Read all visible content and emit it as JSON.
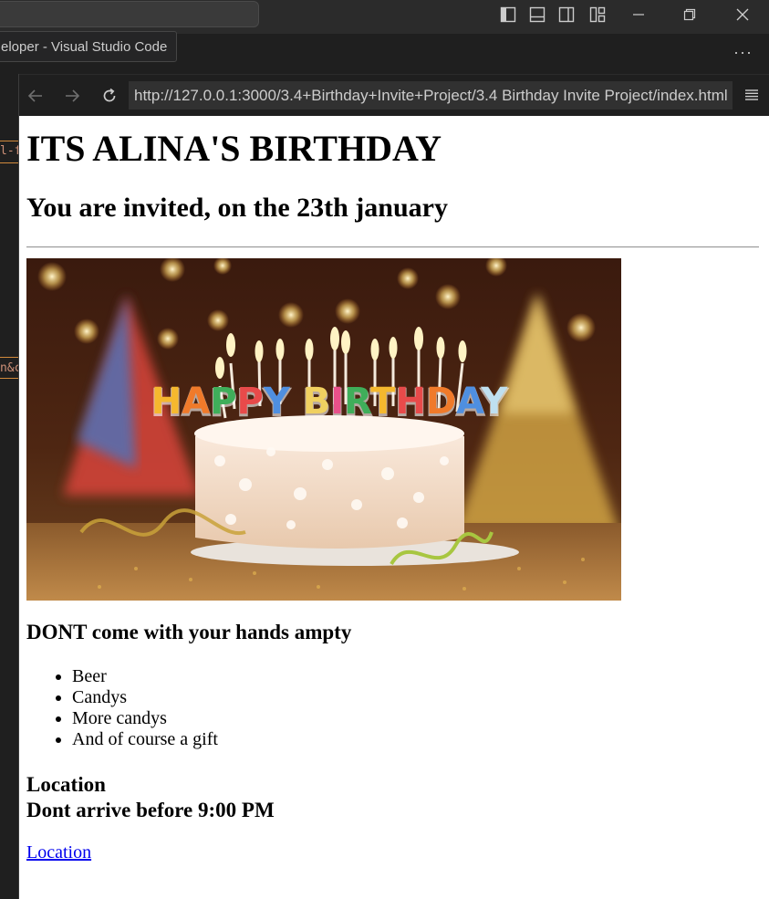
{
  "vscode": {
    "window_title_fragment": "eloper - Visual Studio Code",
    "more_actions": "···"
  },
  "editor_fragments": {
    "line_1": "l-f",
    "line_2": "n&c"
  },
  "browser": {
    "url": "http://127.0.0.1:3000/3.4+Birthday+Invite+Project/3.4 Birthday Invite Project/index.html"
  },
  "page": {
    "heading": "ITS ALINA'S BIRTHDAY",
    "subheading": "You are invited, on the 23th january",
    "image_text": "HAPPY BIRTHDAY",
    "bring_heading": "DONT come with your hands ampty",
    "items": [
      "Beer",
      "Candys",
      "More candys",
      "And of course a gift"
    ],
    "location_heading": "Location",
    "arrival_note": "Dont arrive before 9:00 PM",
    "location_link": "Location"
  },
  "colors": {
    "titlebar_bg": "#2b2b2b",
    "editor_bg": "#1f1f1f",
    "url_field_bg": "#313131",
    "link": "#0000ee",
    "string_orange": "#ce9178"
  }
}
